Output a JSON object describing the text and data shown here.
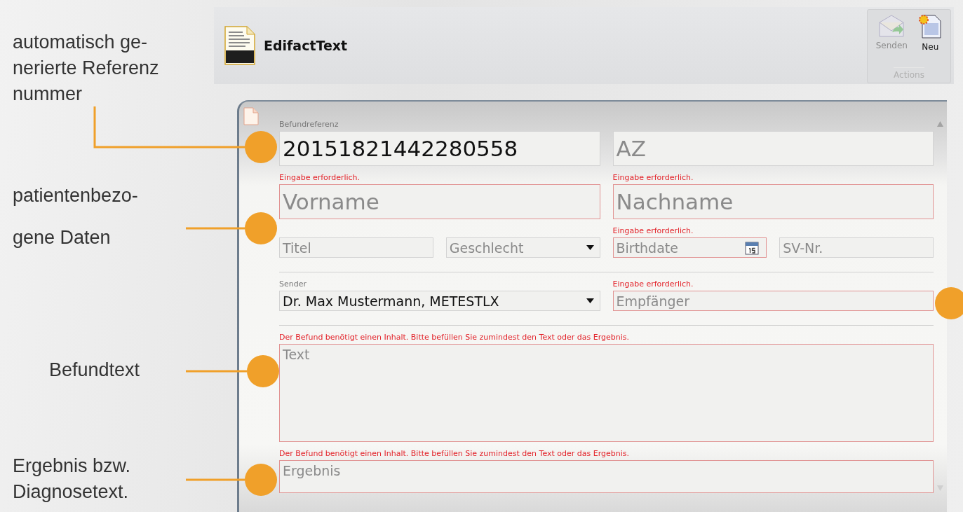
{
  "annotations": [
    {
      "text": "automatisch ge-\nnerierte Referenz\nnummer"
    },
    {
      "text": "patientenbezo-\ngene Daten"
    },
    {
      "text": "Befundtext"
    },
    {
      "text": "Ergebnis bzw.\nDiagnosetext."
    }
  ],
  "header": {
    "title": "EdifactText"
  },
  "toolbar": {
    "group_label": "Actions",
    "buttons": [
      {
        "label": "Senden",
        "kind": "send",
        "disabled": true
      },
      {
        "label": "Neu",
        "kind": "new",
        "disabled": false
      }
    ]
  },
  "form": {
    "rows": [
      {
        "kind": "fields",
        "large": true,
        "fields": [
          {
            "kind": "text",
            "label": "Befundreferenz",
            "value": "20151821442280558",
            "invalid": false
          },
          {
            "kind": "text",
            "placeholder": "AZ",
            "invalid": false
          }
        ]
      },
      {
        "kind": "fields",
        "large": true,
        "fields": [
          {
            "kind": "text",
            "error": "Eingabe erforderlich.",
            "placeholder": "Vorname",
            "invalid": true
          },
          {
            "kind": "text",
            "error": "Eingabe erforderlich.",
            "placeholder": "Nachname",
            "invalid": true
          }
        ]
      },
      {
        "kind": "fields",
        "large": false,
        "fields": [
          {
            "kind": "text",
            "placeholder": "Titel",
            "invalid": false
          },
          {
            "kind": "select",
            "placeholder": "Geschlecht",
            "invalid": false
          },
          {
            "kind": "date",
            "error": "Eingabe erforderlich.",
            "placeholder": "Birthdate",
            "invalid": true
          },
          {
            "kind": "text",
            "placeholder": "SV-Nr.",
            "invalid": false
          }
        ]
      },
      {
        "kind": "divider"
      },
      {
        "kind": "fields",
        "large": false,
        "fields": [
          {
            "kind": "select",
            "label": "Sender",
            "value": "Dr. Max Mustermann, METESTLX",
            "invalid": false
          },
          {
            "kind": "text",
            "error": "Eingabe erforderlich.",
            "placeholder": "Empfänger",
            "invalid": true
          }
        ]
      },
      {
        "kind": "divider"
      },
      {
        "kind": "area",
        "error": "Der Befund benötigt einen Inhalt. Bitte befüllen Sie zumindest den Text oder das Ergebnis.",
        "placeholder": "Text",
        "invalid": true
      },
      {
        "kind": "area",
        "error": "Der Befund benötigt einen Inhalt. Bitte befüllen Sie zumindest den Text oder das Ergebnis.",
        "placeholder": "Ergebnis",
        "invalid": true
      }
    ]
  }
}
